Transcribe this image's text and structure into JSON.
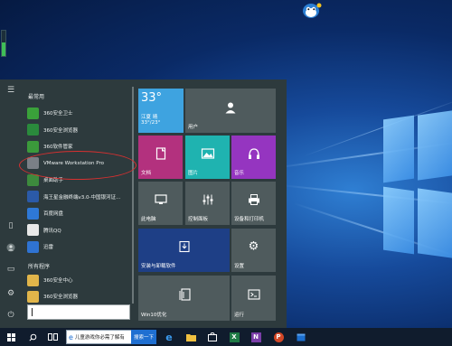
{
  "start_menu": {
    "section_recent": "最常用",
    "section_all": "所有程序",
    "recent_apps": [
      {
        "label": "360安全卫士",
        "icon": "360-safeguard-icon",
        "color": "#3aa13a"
      },
      {
        "label": "360安全浏览器",
        "icon": "360-browser-icon",
        "color": "#2a8a3c"
      },
      {
        "label": "360软件管家",
        "icon": "360-software-manager-icon",
        "color": "#3b9a3b"
      },
      {
        "label": "VMware Workstation Pro",
        "icon": "vmware-icon",
        "color": "#7a7f86"
      },
      {
        "label": "桌面助手",
        "icon": "desktop-assistant-icon",
        "color": "#3d8a3d"
      },
      {
        "label": "海王星金融终端v3.0-中国银河证...",
        "icon": "neptune-terminal-icon",
        "color": "#2b5aa8"
      },
      {
        "label": "百度网盘",
        "icon": "baidu-netdisk-icon",
        "color": "#2e78d6"
      },
      {
        "label": "腾讯QQ",
        "icon": "qq-icon",
        "color": "#e8e8e8"
      },
      {
        "label": "迅雷",
        "icon": "xunlei-icon",
        "color": "#2f73d2"
      }
    ],
    "all_apps": [
      {
        "label": "360安全中心",
        "icon": "folder-icon",
        "color": "#e1b54a"
      },
      {
        "label": "360安全浏览器",
        "icon": "folder-icon",
        "color": "#e1b54a"
      }
    ],
    "rail": {
      "menu": "hamburger-menu-icon",
      "documents": "document-icon",
      "user": "user-icon",
      "pictures": "pictures-icon",
      "settings": "settings-icon",
      "power": "power-icon"
    }
  },
  "tiles": {
    "weather": {
      "temp": "33°",
      "city": "江夏 晴",
      "range": "33°/23°",
      "color": "#3ea3e0"
    },
    "user": {
      "label": "用户",
      "color": "#4f5b5d"
    },
    "documents": {
      "label": "文档",
      "color": "#b3317e"
    },
    "pictures": {
      "label": "图片",
      "color": "#1fb3b0"
    },
    "music": {
      "label": "音乐",
      "color": "#9535c0"
    },
    "this_pc": {
      "label": "此电脑",
      "color": "#4f5b5d"
    },
    "control_panel": {
      "label": "控制面板",
      "color": "#4f5b5d"
    },
    "devices": {
      "label": "设备和打印机",
      "color": "#4f5b5d"
    },
    "programs": {
      "label": "安装与卸载软件",
      "color": "#1e3f86"
    },
    "settings": {
      "label": "设置",
      "color": "#4f5b5d"
    },
    "win10_tips": {
      "label": "Win10优化",
      "color": "#4f5b5d"
    },
    "run": {
      "label": "运行",
      "color": "#4f5b5d"
    }
  },
  "taskbar": {
    "search_text": "儿童游戏你必需了解有什么?",
    "search_button": "搜索一下",
    "apps": [
      "windows-start-icon",
      "search-icon",
      "task-view-icon",
      "edge-icon",
      "file-explorer-icon",
      "store-icon",
      "excel-icon",
      "onenote-icon",
      "powerpoint-icon",
      "calendar-icon"
    ]
  },
  "desktop": {
    "gauge_fraction": 0.55
  }
}
